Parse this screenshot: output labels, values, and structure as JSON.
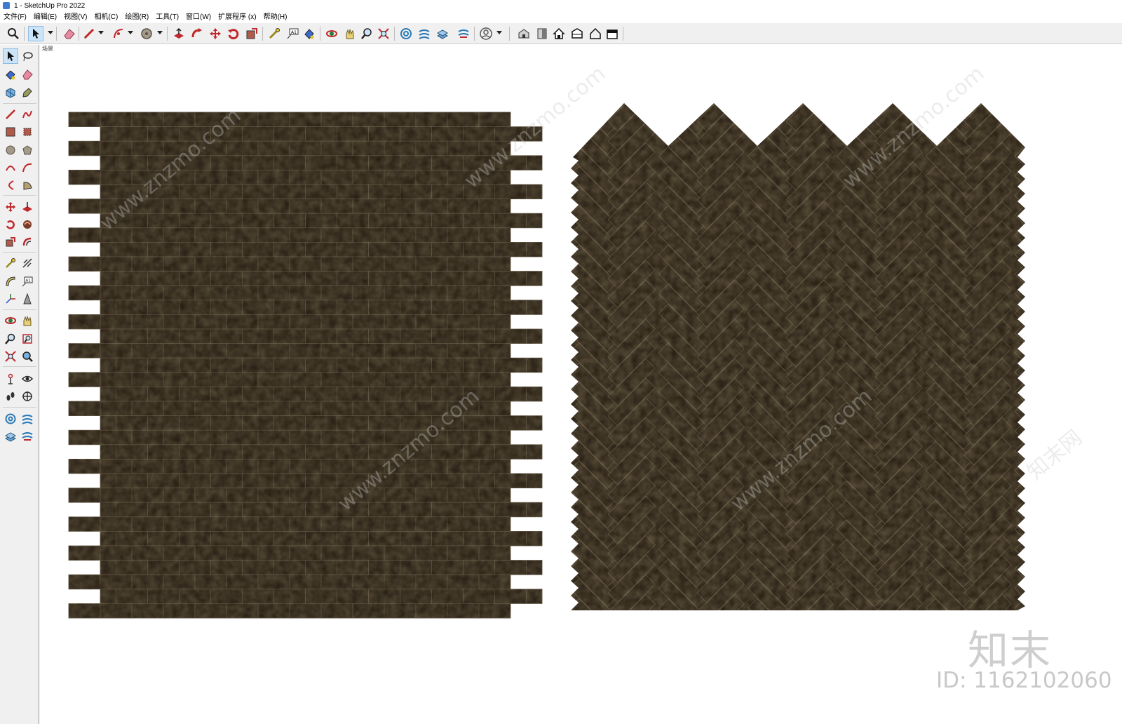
{
  "window": {
    "title": "1 - SketchUp Pro 2022",
    "app_icon": "sketchup-logo-icon"
  },
  "menu": [
    "文件(F)",
    "编辑(E)",
    "视图(V)",
    "相机(C)",
    "绘图(R)",
    "工具(T)",
    "窗口(W)",
    "扩展程序 (x)",
    "帮助(H)"
  ],
  "toolbar": {
    "tools": [
      "search-icon",
      "select-icon",
      "eraser-icon",
      "pencil-icon",
      "arc-icon",
      "circle-icon",
      "push-pull-icon",
      "follow-me-icon",
      "move-icon",
      "rotate-icon",
      "scale-icon",
      "tape-measure-icon",
      "text-icon",
      "paint-bucket-icon",
      "orbit-icon",
      "pan-icon",
      "zoom-icon",
      "zoom-extents-icon",
      "sandbox-icon",
      "smoove-icon",
      "stamp-icon",
      "drape-icon",
      "user-icon",
      "warehouse-icon",
      "extension-icon",
      "home-icon",
      "share-icon",
      "house-outline-icon",
      "export-icon"
    ]
  },
  "viewport": {
    "scene_label": "场景",
    "background": "#ffffff",
    "tile_color": "#221a10",
    "grout_color": "#4a3f30"
  },
  "branding": {
    "logo_text": "知末",
    "id_text": "ID: 1162102060"
  },
  "watermark": {
    "text": "www.znzmo.com",
    "cn_text": "知末网"
  }
}
